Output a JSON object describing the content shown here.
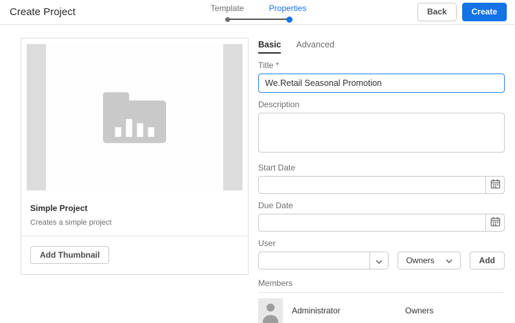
{
  "header": {
    "title": "Create Project",
    "steps": [
      {
        "label": "Template",
        "state": "done"
      },
      {
        "label": "Properties",
        "state": "active"
      }
    ],
    "actions": {
      "back": "Back",
      "create": "Create"
    }
  },
  "colors": {
    "accent": "#1473e6",
    "step_done": "#6e6e6e",
    "border": "#c9c9c9"
  },
  "template_card": {
    "title": "Simple Project",
    "description": "Creates a simple project",
    "add_thumbnail": "Add Thumbnail",
    "thumbnail_icon": "folder-bar-chart-placeholder"
  },
  "form": {
    "tabs": [
      {
        "label": "Basic",
        "active": true
      },
      {
        "label": "Advanced",
        "active": false
      }
    ],
    "title_field": {
      "label": "Title *",
      "value": "We.Retail Seasonal Promotion"
    },
    "description_field": {
      "label": "Description",
      "value": ""
    },
    "start_date_field": {
      "label": "Start Date",
      "value": ""
    },
    "due_date_field": {
      "label": "Due Date",
      "value": ""
    },
    "user_field": {
      "label": "User",
      "value": "",
      "role_selected": "Owners",
      "add": "Add"
    },
    "members": {
      "label": "Members",
      "rows": [
        {
          "name": "Administrator",
          "role": "Owners"
        }
      ]
    }
  }
}
